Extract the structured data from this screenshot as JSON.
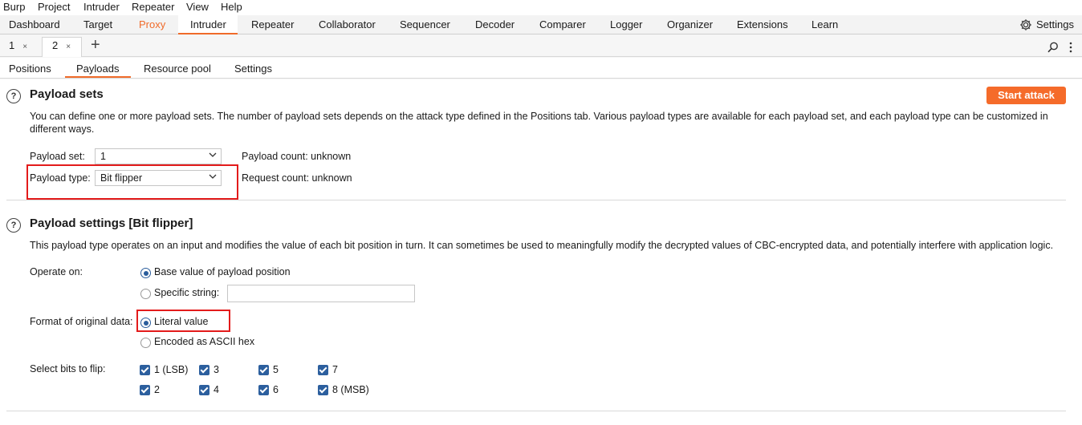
{
  "menu": [
    "Burp",
    "Project",
    "Intruder",
    "Repeater",
    "View",
    "Help"
  ],
  "main_tabs": [
    "Dashboard",
    "Target",
    "Proxy",
    "Intruder",
    "Repeater",
    "Collaborator",
    "Sequencer",
    "Decoder",
    "Comparer",
    "Logger",
    "Organizer",
    "Extensions",
    "Learn"
  ],
  "settings_label": "Settings",
  "sub_tabs": [
    "1",
    "2"
  ],
  "add_tab": "+",
  "close_glyph": "×",
  "section_tabs": [
    "Positions",
    "Payloads",
    "Resource pool",
    "Settings"
  ],
  "help_glyph": "?",
  "payload_sets": {
    "title": "Payload sets",
    "description": "You can define one or more payload sets. The number of payload sets depends on the attack type defined in the Positions tab. Various payload types are available for each payload set, and each payload type can be customized in different ways.",
    "set_label": "Payload set:",
    "set_value": "1",
    "type_label": "Payload type:",
    "type_value": "Bit flipper",
    "payload_count": "Payload count:  unknown",
    "request_count": "Request count:  unknown",
    "start_attack": "Start attack"
  },
  "payload_settings": {
    "title": "Payload settings [Bit flipper]",
    "description": "This payload type operates on an input and modifies the value of each bit position in turn. It can sometimes be used to meaningfully modify the decrypted values of CBC-encrypted data, and potentially interfere with application logic.",
    "operate_on_label": "Operate on:",
    "base_value": "Base value of payload position",
    "specific_string": "Specific string:",
    "format_label": "Format of original data:",
    "literal_value": "Literal value",
    "encoded_hex": "Encoded as ASCII hex",
    "bits_label": "Select bits to flip:",
    "bits": [
      "1 (LSB)",
      "3",
      "5",
      "7",
      "2",
      "4",
      "6",
      "8 (MSB)"
    ]
  },
  "colors": {
    "accent": "#f56b2a",
    "highlight": "#e31b1b",
    "check": "#2c5f9e"
  }
}
